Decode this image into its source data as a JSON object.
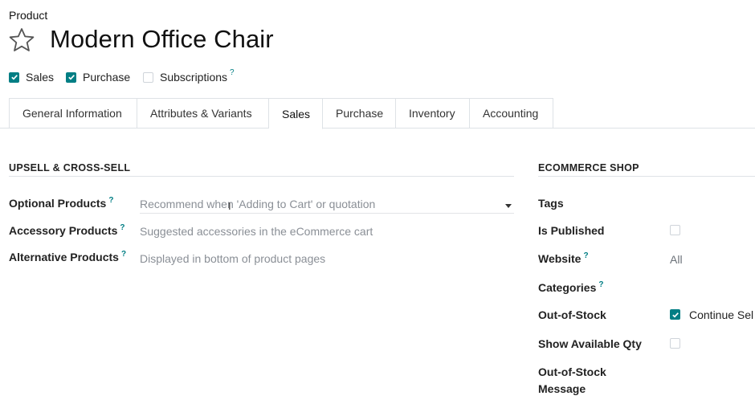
{
  "breadcrumb": "Product",
  "product": {
    "name": "Modern Office Chair",
    "favorite_icon": "star-icon"
  },
  "flags": [
    {
      "label": "Sales",
      "checked": true,
      "help": ""
    },
    {
      "label": "Purchase",
      "checked": true,
      "help": ""
    },
    {
      "label": "Subscriptions",
      "checked": false,
      "help": "?"
    }
  ],
  "tabs": [
    {
      "label": "General Information",
      "active": false
    },
    {
      "label": "Attributes & Variants",
      "active": false
    },
    {
      "label": "Sales",
      "active": true
    },
    {
      "label": "Purchase",
      "active": false
    },
    {
      "label": "Inventory",
      "active": false
    },
    {
      "label": "Accounting",
      "active": false
    }
  ],
  "upsell": {
    "title": "UPSELL & CROSS-SELL",
    "fields": [
      {
        "label": "Optional Products",
        "help": "?",
        "placeholder": "Recommend when 'Adding to Cart' or quotation"
      },
      {
        "label": "Accessory Products",
        "help": "?",
        "placeholder": "Suggested accessories in the eCommerce cart"
      },
      {
        "label": "Alternative Products",
        "help": "?",
        "placeholder": "Displayed in bottom of product pages"
      }
    ]
  },
  "ecommerce": {
    "title": "ECOMMERCE SHOP",
    "tags_label": "Tags",
    "is_published_label": "Is Published",
    "is_published": false,
    "website_label": "Website",
    "website_help": "?",
    "website_value": "All",
    "categories_label": "Categories",
    "categories_help": "?",
    "out_of_stock_label": "Out-of-Stock",
    "out_of_stock_checked": true,
    "out_of_stock_value": "Continue Sel",
    "show_qty_label": "Show Available Qty",
    "show_qty": false,
    "oos_message_label_1": "Out-of-Stock",
    "oos_message_label_2": "Message"
  },
  "colors": {
    "accent": "#017e84",
    "border": "#dee2e6",
    "placeholder": "#8a8f96"
  }
}
